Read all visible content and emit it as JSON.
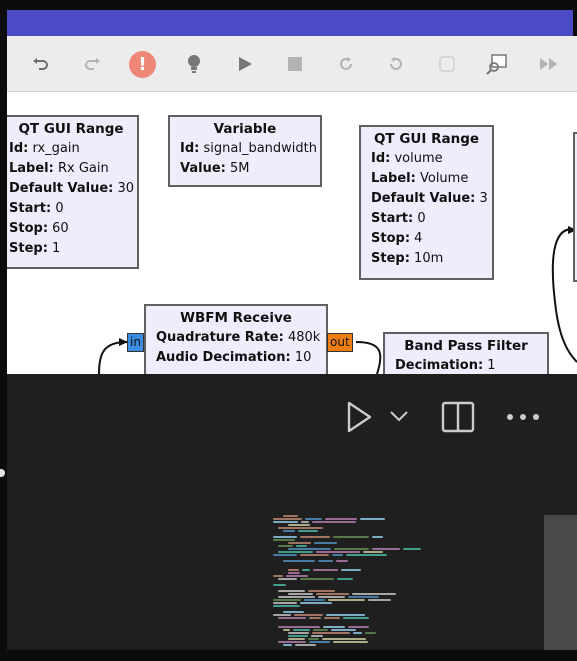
{
  "toolbar": {
    "icons": [
      "undo-icon",
      "redo-icon",
      "error-icon",
      "bulb-icon",
      "play-icon",
      "stop-icon",
      "reload-icon",
      "refresh-icon",
      "blank-icon",
      "find-block-icon",
      "fast-forward-icon"
    ],
    "error_glyph": "!"
  },
  "blocks": {
    "rx_range": {
      "title": "QT GUI Range",
      "rows": [
        {
          "key": "Id:",
          "value": "rx_gain"
        },
        {
          "key": "Label:",
          "value": "Rx Gain"
        },
        {
          "key": "Default Value:",
          "value": "30"
        },
        {
          "key": "Start:",
          "value": "0"
        },
        {
          "key": "Stop:",
          "value": "60"
        },
        {
          "key": "Step:",
          "value": "1"
        }
      ]
    },
    "variable": {
      "title": "Variable",
      "rows": [
        {
          "key": "Id:",
          "value": "signal_bandwidth"
        },
        {
          "key": "Value:",
          "value": "5M"
        }
      ]
    },
    "volume_range": {
      "title": "QT GUI Range",
      "rows": [
        {
          "key": "Id:",
          "value": "volume"
        },
        {
          "key": "Label:",
          "value": "Volume"
        },
        {
          "key": "Default Value:",
          "value": "3"
        },
        {
          "key": "Start:",
          "value": "0"
        },
        {
          "key": "Stop:",
          "value": "4"
        },
        {
          "key": "Step:",
          "value": "10m"
        }
      ]
    },
    "wbfm": {
      "title": "WBFM Receive",
      "rows": [
        {
          "key": "Quadrature Rate:",
          "value": "480k"
        },
        {
          "key": "Audio Decimation:",
          "value": "10"
        }
      ],
      "port_in": "in",
      "port_out": "out"
    },
    "bpf": {
      "title": "Band Pass Filter",
      "rows": [
        {
          "key": "Decimation:",
          "value": "1"
        }
      ]
    }
  },
  "vscode": {
    "icons": [
      "run-icon",
      "dropdown-chevron-icon",
      "split-editor-icon",
      "more-actions-icon"
    ],
    "run_glyph": "▷",
    "chevron_glyph": "⌄",
    "more_glyph": "···"
  },
  "colors": {
    "title_bar": "#4b4bc6",
    "block_fill": "#f0ecfb",
    "port_in": "#3a8de0",
    "port_out": "#ee7d14",
    "editor_bg": "#1f1f1f"
  }
}
